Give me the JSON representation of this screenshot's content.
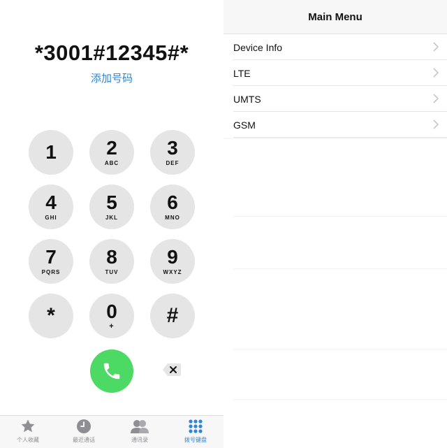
{
  "dialer": {
    "number": "*3001#12345#*",
    "add_number": "添加号码",
    "keys": [
      {
        "digit": "1",
        "letters": ""
      },
      {
        "digit": "2",
        "letters": "ABC"
      },
      {
        "digit": "3",
        "letters": "DEF"
      },
      {
        "digit": "4",
        "letters": "GHI"
      },
      {
        "digit": "5",
        "letters": "JKL"
      },
      {
        "digit": "6",
        "letters": "MNO"
      },
      {
        "digit": "7",
        "letters": "PQRS"
      },
      {
        "digit": "8",
        "letters": "TUV"
      },
      {
        "digit": "9",
        "letters": "WXYZ"
      },
      {
        "digit": "*",
        "letters": ""
      },
      {
        "digit": "0",
        "letters": "+"
      },
      {
        "digit": "#",
        "letters": ""
      }
    ],
    "call_icon": "phone-icon",
    "delete_icon": "backspace-icon",
    "accent": "#4cd964"
  },
  "tabbar": {
    "tabs": [
      {
        "label": "个人收藏",
        "icon": "star-icon"
      },
      {
        "label": "最近通话",
        "icon": "clock-icon"
      },
      {
        "label": "通讯录",
        "icon": "contacts-icon"
      },
      {
        "label": "拨号键盘",
        "icon": "keypad-icon",
        "active": true
      }
    ],
    "active_color": "#2e86d9"
  },
  "main_menu": {
    "title": "Main Menu",
    "items": [
      {
        "label": "Device Info"
      },
      {
        "label": "LTE"
      },
      {
        "label": "UMTS"
      },
      {
        "label": "GSM"
      }
    ],
    "chevron_icon": "chevron-right-icon"
  }
}
